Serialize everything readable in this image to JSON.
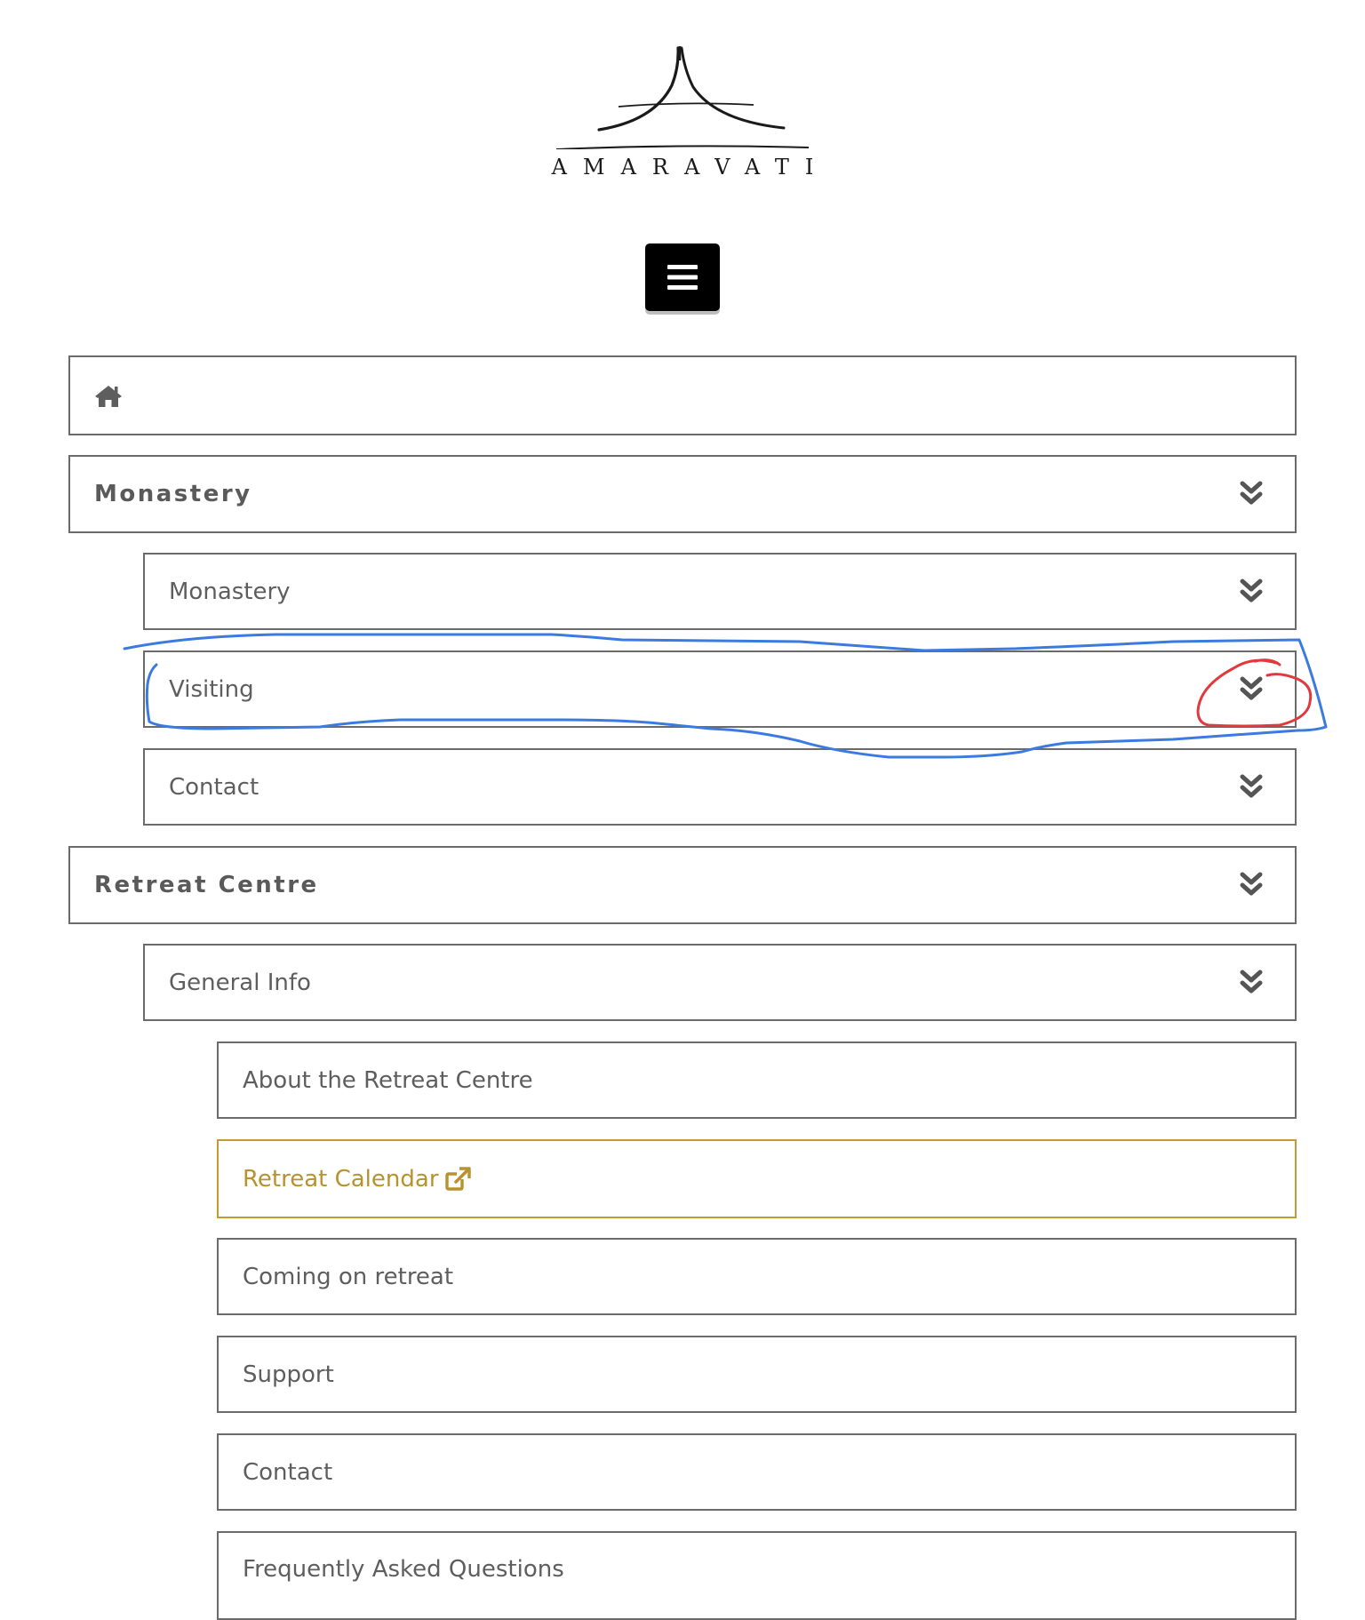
{
  "header": {
    "logo_text": "AMARAVATI"
  },
  "menu_toggle": {
    "icon": "hamburger-icon"
  },
  "nav": {
    "home": {
      "icon": "home-icon"
    },
    "monastery": {
      "label": "Monastery",
      "icon": "double-chevron-down-icon",
      "children": {
        "monastery": {
          "label": "Monastery",
          "icon": "double-chevron-down-icon"
        },
        "visiting": {
          "label": "Visiting",
          "icon": "double-chevron-down-icon"
        },
        "contact": {
          "label": "Contact",
          "icon": "double-chevron-down-icon"
        }
      }
    },
    "retreat_centre": {
      "label": "Retreat Centre",
      "icon": "double-chevron-down-icon",
      "children": {
        "general_info": {
          "label": "General Info",
          "icon": "double-chevron-down-icon",
          "children": {
            "about": {
              "label": "About the Retreat Centre"
            },
            "calendar": {
              "label": "Retreat Calendar",
              "icon": "external-link-icon"
            },
            "coming": {
              "label": "Coming on retreat"
            },
            "support": {
              "label": "Support"
            },
            "contact": {
              "label": "Contact"
            },
            "faq": {
              "label": "Frequently Asked Questions"
            }
          }
        }
      }
    }
  },
  "colors": {
    "border": "#6b6b6b",
    "text": "#5e5e5e",
    "accent_gold": "#c49a32",
    "annotation_blue": "#3b7be0",
    "annotation_red": "#e0393e"
  }
}
